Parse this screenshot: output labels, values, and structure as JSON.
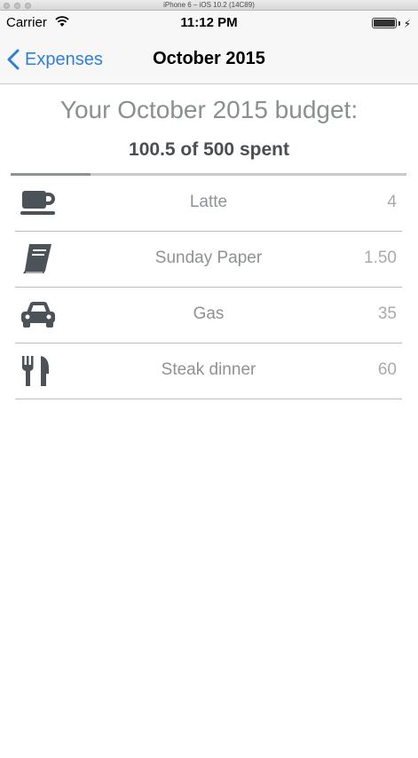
{
  "simulator": {
    "title": "iPhone 6 – iOS 10.2 (14C89)"
  },
  "status_bar": {
    "carrier": "Carrier",
    "time": "11:12 PM"
  },
  "nav": {
    "back_label": "Expenses",
    "title": "October 2015"
  },
  "budget": {
    "title": "Your October 2015 budget:",
    "spent_text": "100.5 of 500 spent",
    "spent": 100.5,
    "total": 500
  },
  "expenses": [
    {
      "icon": "coffee-cup-icon",
      "name": "Latte",
      "amount": "4"
    },
    {
      "icon": "book-icon",
      "name": "Sunday Paper",
      "amount": "1.50"
    },
    {
      "icon": "car-icon",
      "name": "Gas",
      "amount": "35"
    },
    {
      "icon": "fork-knife-icon",
      "name": "Steak dinner",
      "amount": "60"
    }
  ],
  "colors": {
    "accent": "#2f7fd8",
    "icon": "#4b5358",
    "text_muted": "#8e9294"
  }
}
